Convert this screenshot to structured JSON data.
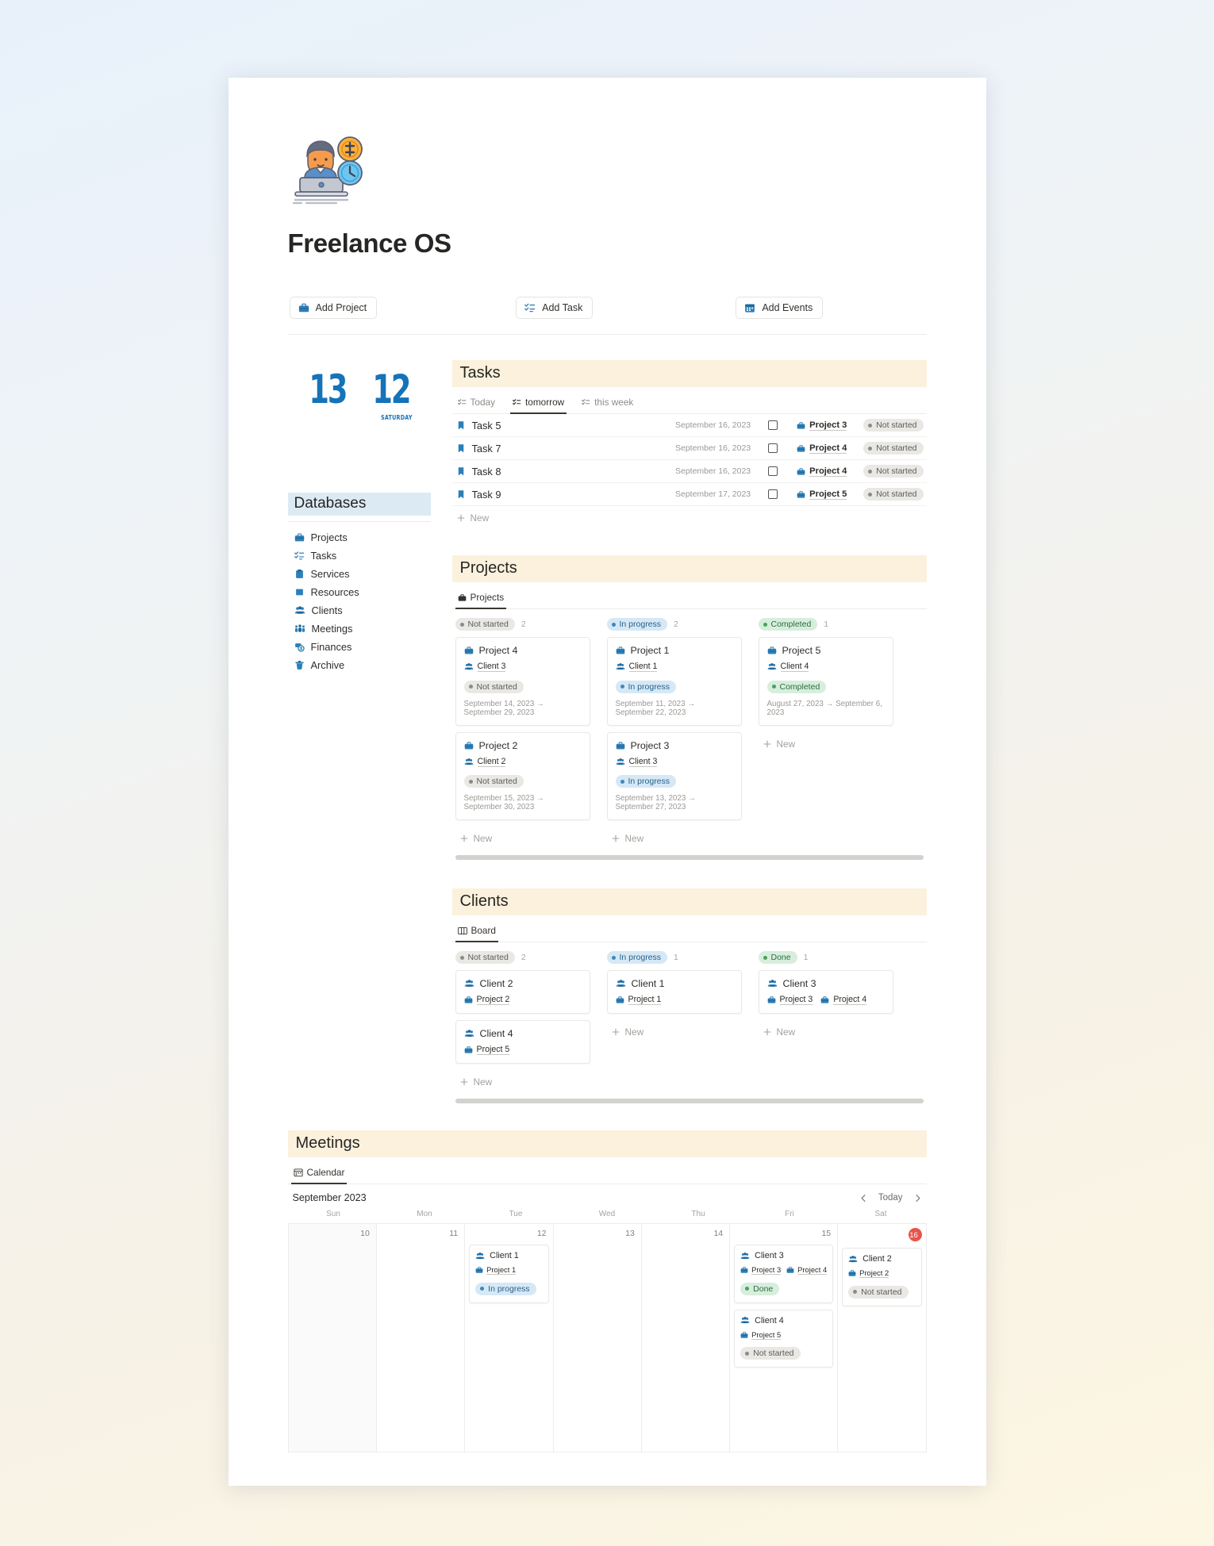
{
  "header": {
    "title": "Freelance OS",
    "icon": "freelancer-laptop-illustration"
  },
  "toolbar": {
    "buttons": [
      {
        "label": "Add Project",
        "icon": "briefcase-icon"
      },
      {
        "label": "Add Task",
        "icon": "checklist-icon"
      },
      {
        "label": "Add Events",
        "icon": "calendar-icon"
      }
    ]
  },
  "date_widget": {
    "number_left": "13",
    "number_right": "12",
    "weekday": "SATURDAY"
  },
  "sidebar": {
    "title": "Databases",
    "items": [
      {
        "label": "Projects",
        "icon": "briefcase-icon"
      },
      {
        "label": "Tasks",
        "icon": "checklist-icon"
      },
      {
        "label": "Services",
        "icon": "clipboard-icon"
      },
      {
        "label": "Resources",
        "icon": "book-icon"
      },
      {
        "label": "Clients",
        "icon": "people-icon"
      },
      {
        "label": "Meetings",
        "icon": "group-meeting-icon"
      },
      {
        "label": "Finances",
        "icon": "money-icon"
      },
      {
        "label": "Archive",
        "icon": "trash-icon"
      }
    ]
  },
  "tasks_section": {
    "title": "Tasks",
    "tabs": [
      {
        "label": "Today",
        "icon": "checklist-icon",
        "active": false
      },
      {
        "label": "tomorrow",
        "icon": "checklist-icon",
        "active": true
      },
      {
        "label": "this week",
        "icon": "checklist-icon",
        "active": false
      }
    ],
    "rows": [
      {
        "name": "Task 5",
        "date": "September 16, 2023",
        "checked": false,
        "project": "Project 3",
        "status": "Not started",
        "status_color": "gray"
      },
      {
        "name": "Task 7",
        "date": "September 16, 2023",
        "checked": false,
        "project": "Project 4",
        "status": "Not started",
        "status_color": "gray"
      },
      {
        "name": "Task 8",
        "date": "September 16, 2023",
        "checked": false,
        "project": "Project 4",
        "status": "Not started",
        "status_color": "gray"
      },
      {
        "name": "Task 9",
        "date": "September 17, 2023",
        "checked": false,
        "project": "Project 5",
        "status": "Not started",
        "status_color": "gray"
      }
    ],
    "new_label": "New"
  },
  "projects_section": {
    "title": "Projects",
    "tab": {
      "label": "Projects",
      "icon": "briefcase-icon"
    },
    "columns": [
      {
        "status": "Not started",
        "color": "gray",
        "count": "2",
        "new_label": "New",
        "cards": [
          {
            "title": "Project 4",
            "client": "Client 3",
            "status": "Not started",
            "color": "gray",
            "dates": "September 14, 2023 → September 29, 2023"
          },
          {
            "title": "Project 2",
            "client": "Client 2",
            "status": "Not started",
            "color": "gray",
            "dates": "September 15, 2023 → September 30, 2023"
          }
        ]
      },
      {
        "status": "In progress",
        "color": "blue",
        "count": "2",
        "new_label": "New",
        "cards": [
          {
            "title": "Project 1",
            "client": "Client 1",
            "status": "In progress",
            "color": "blue",
            "dates": "September 11, 2023 → September 22, 2023"
          },
          {
            "title": "Project 3",
            "client": "Client 3",
            "status": "In progress",
            "color": "blue",
            "dates": "September 13, 2023 → September 27, 2023"
          }
        ]
      },
      {
        "status": "Completed",
        "color": "green",
        "count": "1",
        "new_label": "New",
        "cards": [
          {
            "title": "Project 5",
            "client": "Client 4",
            "status": "Completed",
            "color": "green",
            "dates": "August 27, 2023 → September 6, 2023"
          }
        ]
      }
    ]
  },
  "clients_section": {
    "title": "Clients",
    "tab": {
      "label": "Board",
      "icon": "board-columns-icon"
    },
    "columns": [
      {
        "status": "Not started",
        "color": "gray",
        "count": "2",
        "new_label": "New",
        "cards": [
          {
            "title": "Client 2",
            "projects": [
              "Project 2"
            ]
          },
          {
            "title": "Client 4",
            "projects": [
              "Project 5"
            ]
          }
        ]
      },
      {
        "status": "In progress",
        "color": "blue",
        "count": "1",
        "new_label": "New",
        "cards": [
          {
            "title": "Client 1",
            "projects": [
              "Project 1"
            ]
          }
        ]
      },
      {
        "status": "Done",
        "color": "green",
        "count": "1",
        "new_label": "New",
        "cards": [
          {
            "title": "Client 3",
            "projects": [
              "Project 3",
              "Project 4"
            ]
          }
        ]
      }
    ]
  },
  "meetings_section": {
    "title": "Meetings",
    "tab": {
      "label": "Calendar",
      "icon": "calendar-icon"
    },
    "month": "September 2023",
    "today_label": "Today",
    "prev_icon": "chevron-left-icon",
    "next_icon": "chevron-right-icon",
    "weekdays": [
      "Sun",
      "Mon",
      "Tue",
      "Wed",
      "Thu",
      "Fri",
      "Sat"
    ],
    "days": [
      {
        "num": "10",
        "today": false,
        "events": []
      },
      {
        "num": "11",
        "today": false,
        "events": []
      },
      {
        "num": "12",
        "today": false,
        "events": [
          {
            "title": "Client 1",
            "projects": [
              "Project 1"
            ],
            "status": "In progress",
            "color": "blue"
          }
        ]
      },
      {
        "num": "13",
        "today": false,
        "events": []
      },
      {
        "num": "14",
        "today": false,
        "events": []
      },
      {
        "num": "15",
        "today": false,
        "events": [
          {
            "title": "Client 3",
            "projects": [
              "Project 3",
              "Project 4"
            ],
            "status": "Done",
            "color": "green"
          },
          {
            "title": "Client 4",
            "projects": [
              "Project 5"
            ],
            "status": "Not started",
            "color": "gray"
          }
        ]
      },
      {
        "num": "16",
        "today": true,
        "events": [
          {
            "title": "Client 2",
            "projects": [
              "Project 2"
            ],
            "status": "Not started",
            "color": "gray"
          }
        ]
      }
    ]
  },
  "colors": {
    "accent_blue": "#1573b8",
    "section_header_bg": "#fbf1dc",
    "database_header_bg": "#dceaf4",
    "today_badge": "#e8544a"
  }
}
